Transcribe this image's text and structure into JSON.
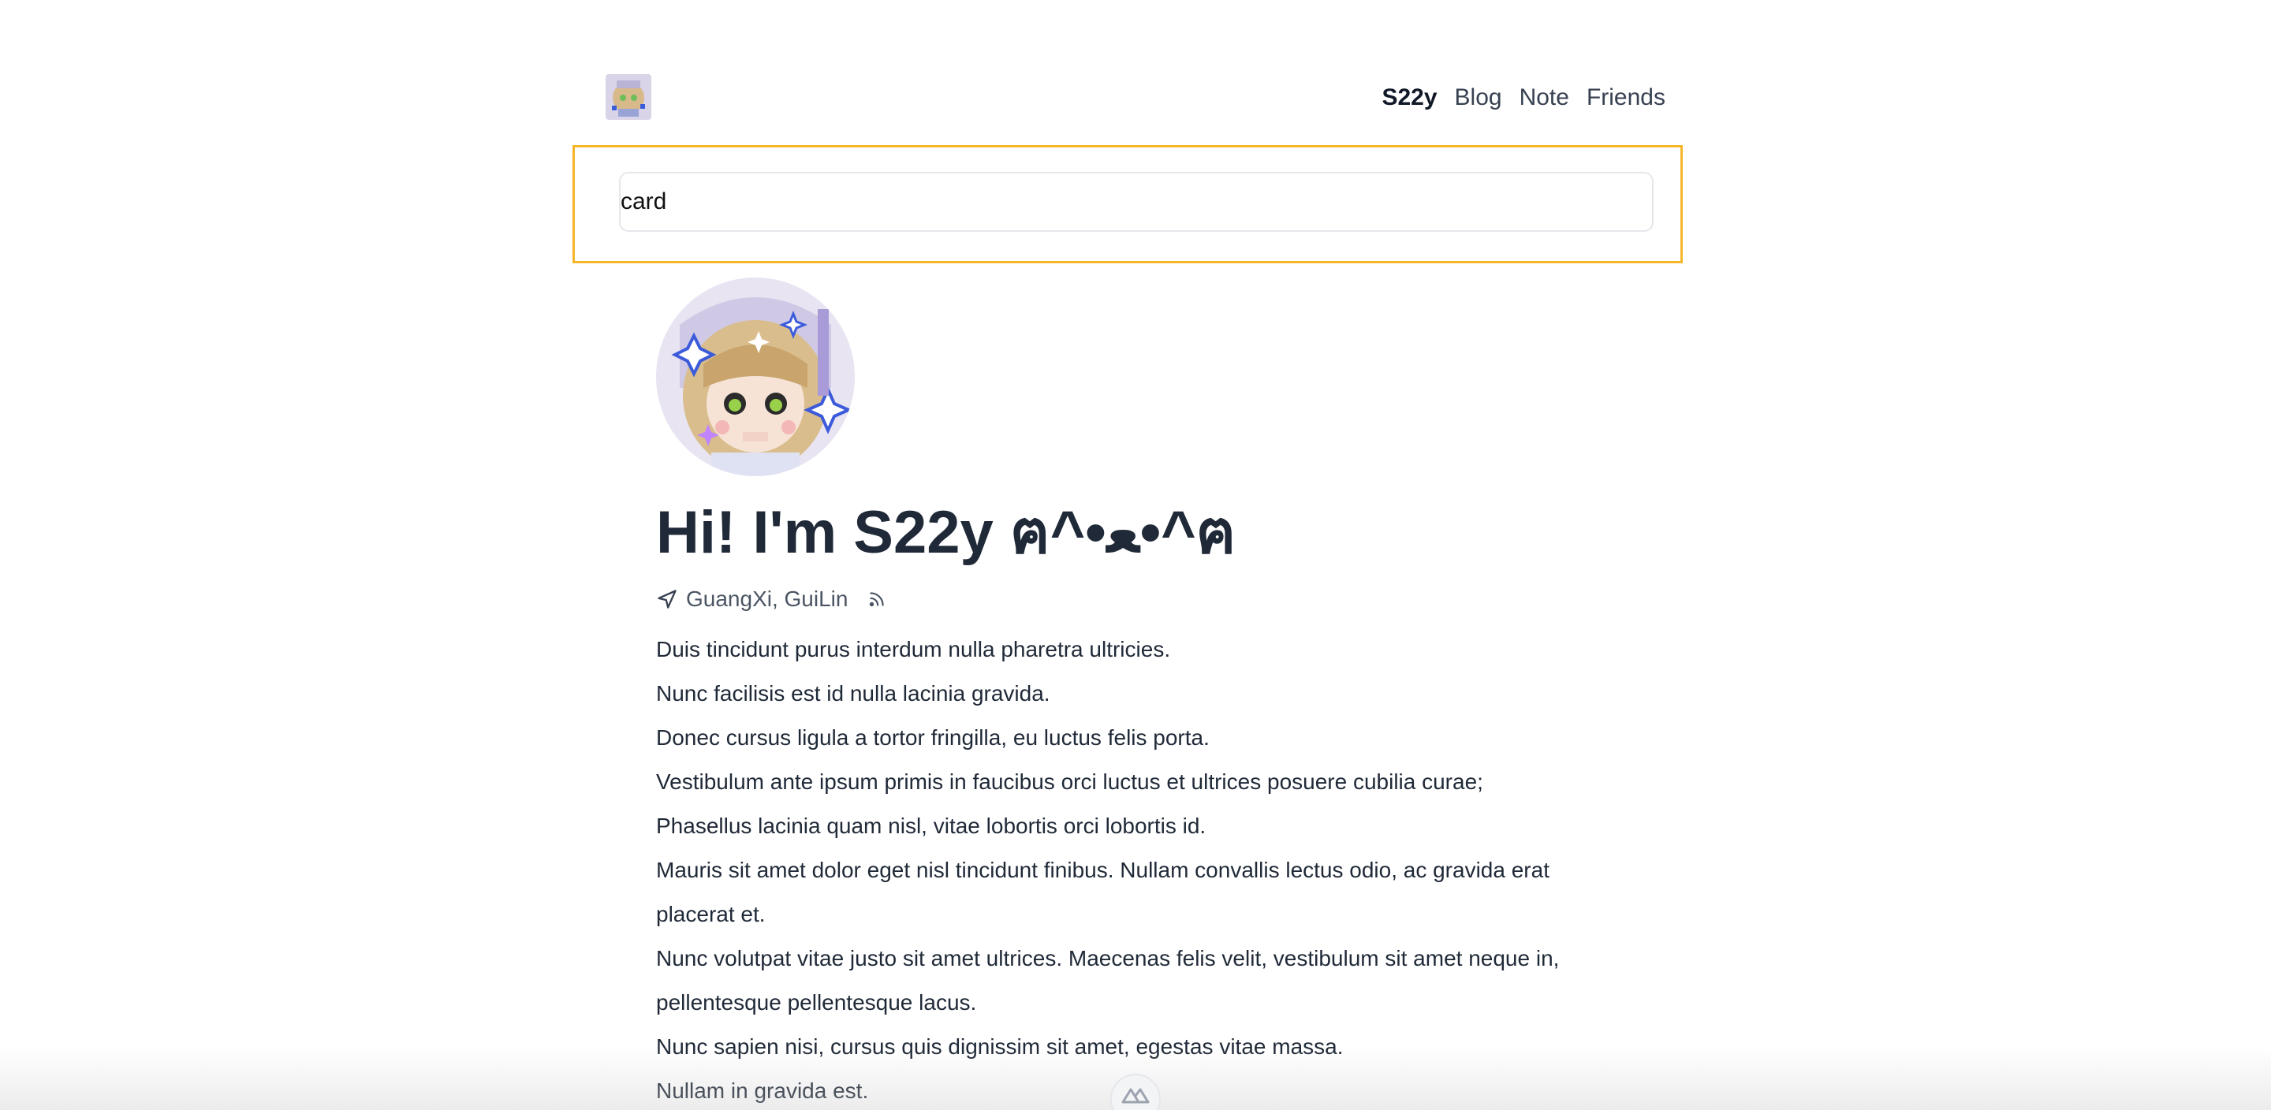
{
  "header": {
    "logo_alt": "site-logo",
    "nav": [
      {
        "label": "S22y",
        "active": true
      },
      {
        "label": "Blog",
        "active": false
      },
      {
        "label": "Note",
        "active": false
      },
      {
        "label": "Friends",
        "active": false
      }
    ]
  },
  "search": {
    "value": "card",
    "highlight_color": "#f5b62a"
  },
  "profile": {
    "title": "Hi! I'm S22y ฅ^•ﻌ•^ฅ",
    "location": "GuangXi, GuiLin",
    "location_icon": "navigation-arrow-icon",
    "rss_icon": "rss-icon"
  },
  "paragraphs": [
    "Duis tincidunt purus interdum nulla pharetra ultricies.",
    "Nunc facilisis est id nulla lacinia gravida.",
    "Donec cursus ligula a tortor fringilla, eu luctus felis porta.",
    "Vestibulum ante ipsum primis in faucibus orci luctus et ultrices posuere cubilia curae;",
    "Phasellus lacinia quam nisl, vitae lobortis orci lobortis id.",
    "Mauris sit amet dolor eget nisl tincidunt finibus. Nullam convallis lectus odio, ac gravida erat placerat et.",
    "Nunc volutpat vitae justo sit amet ultrices. Maecenas felis velit, vestibulum sit amet neque in, pellentesque pellentesque lacus.",
    "Nunc sapien nisi, cursus quis dignissim sit amet, egestas vitae massa.",
    "Nullam in gravida est."
  ],
  "colors": {
    "text": "#1f2937",
    "muted": "#4b5563",
    "border": "#e5e7eb"
  }
}
